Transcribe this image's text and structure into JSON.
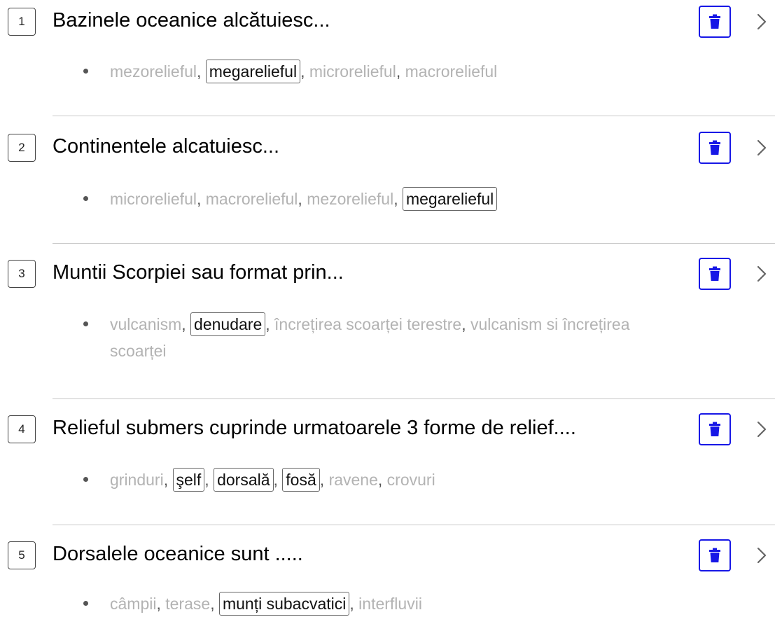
{
  "questions": [
    {
      "number": "1",
      "text": "Bazinele oceanice alcătuiesc...",
      "options": [
        {
          "label": "mezorelieful",
          "correct": false
        },
        {
          "label": "megarelieful",
          "correct": true
        },
        {
          "label": "microrelieful",
          "correct": false
        },
        {
          "label": "macrorelieful",
          "correct": false
        }
      ]
    },
    {
      "number": "2",
      "text": "Continentele alcatuiesc...",
      "options": [
        {
          "label": "microrelieful",
          "correct": false
        },
        {
          "label": "macrorelieful",
          "correct": false
        },
        {
          "label": "mezorelieful",
          "correct": false
        },
        {
          "label": "megarelieful",
          "correct": true
        }
      ]
    },
    {
      "number": "3",
      "text": "Muntii Scorpiei sau format prin...",
      "options": [
        {
          "label": "vulcanism",
          "correct": false
        },
        {
          "label": "denudare",
          "correct": true
        },
        {
          "label": "încrețirea scoarței terestre",
          "correct": false
        },
        {
          "label": "vulcanism si încrețirea scoarței",
          "correct": false
        }
      ]
    },
    {
      "number": "4",
      "text": "Relieful submers cuprinde urmatoarele 3 forme de relief....",
      "options": [
        {
          "label": "grinduri",
          "correct": false
        },
        {
          "label": "şelf",
          "correct": true
        },
        {
          "label": "dorsală",
          "correct": true
        },
        {
          "label": "fosă",
          "correct": true
        },
        {
          "label": "ravene",
          "correct": false
        },
        {
          "label": "crovuri",
          "correct": false
        }
      ]
    },
    {
      "number": "5",
      "text": "Dorsalele oceanice sunt .....",
      "options": [
        {
          "label": "câmpii",
          "correct": false
        },
        {
          "label": "terase",
          "correct": false
        },
        {
          "label": "munți subacvatici",
          "correct": true
        },
        {
          "label": "interfluvii",
          "correct": false
        }
      ]
    }
  ],
  "icons": {
    "delete": "trash-icon",
    "expand": "chevron-right-icon"
  },
  "colors": {
    "accent": "#1717e6",
    "correct_text": "#111111",
    "wrong_text": "#b3b3b3"
  }
}
